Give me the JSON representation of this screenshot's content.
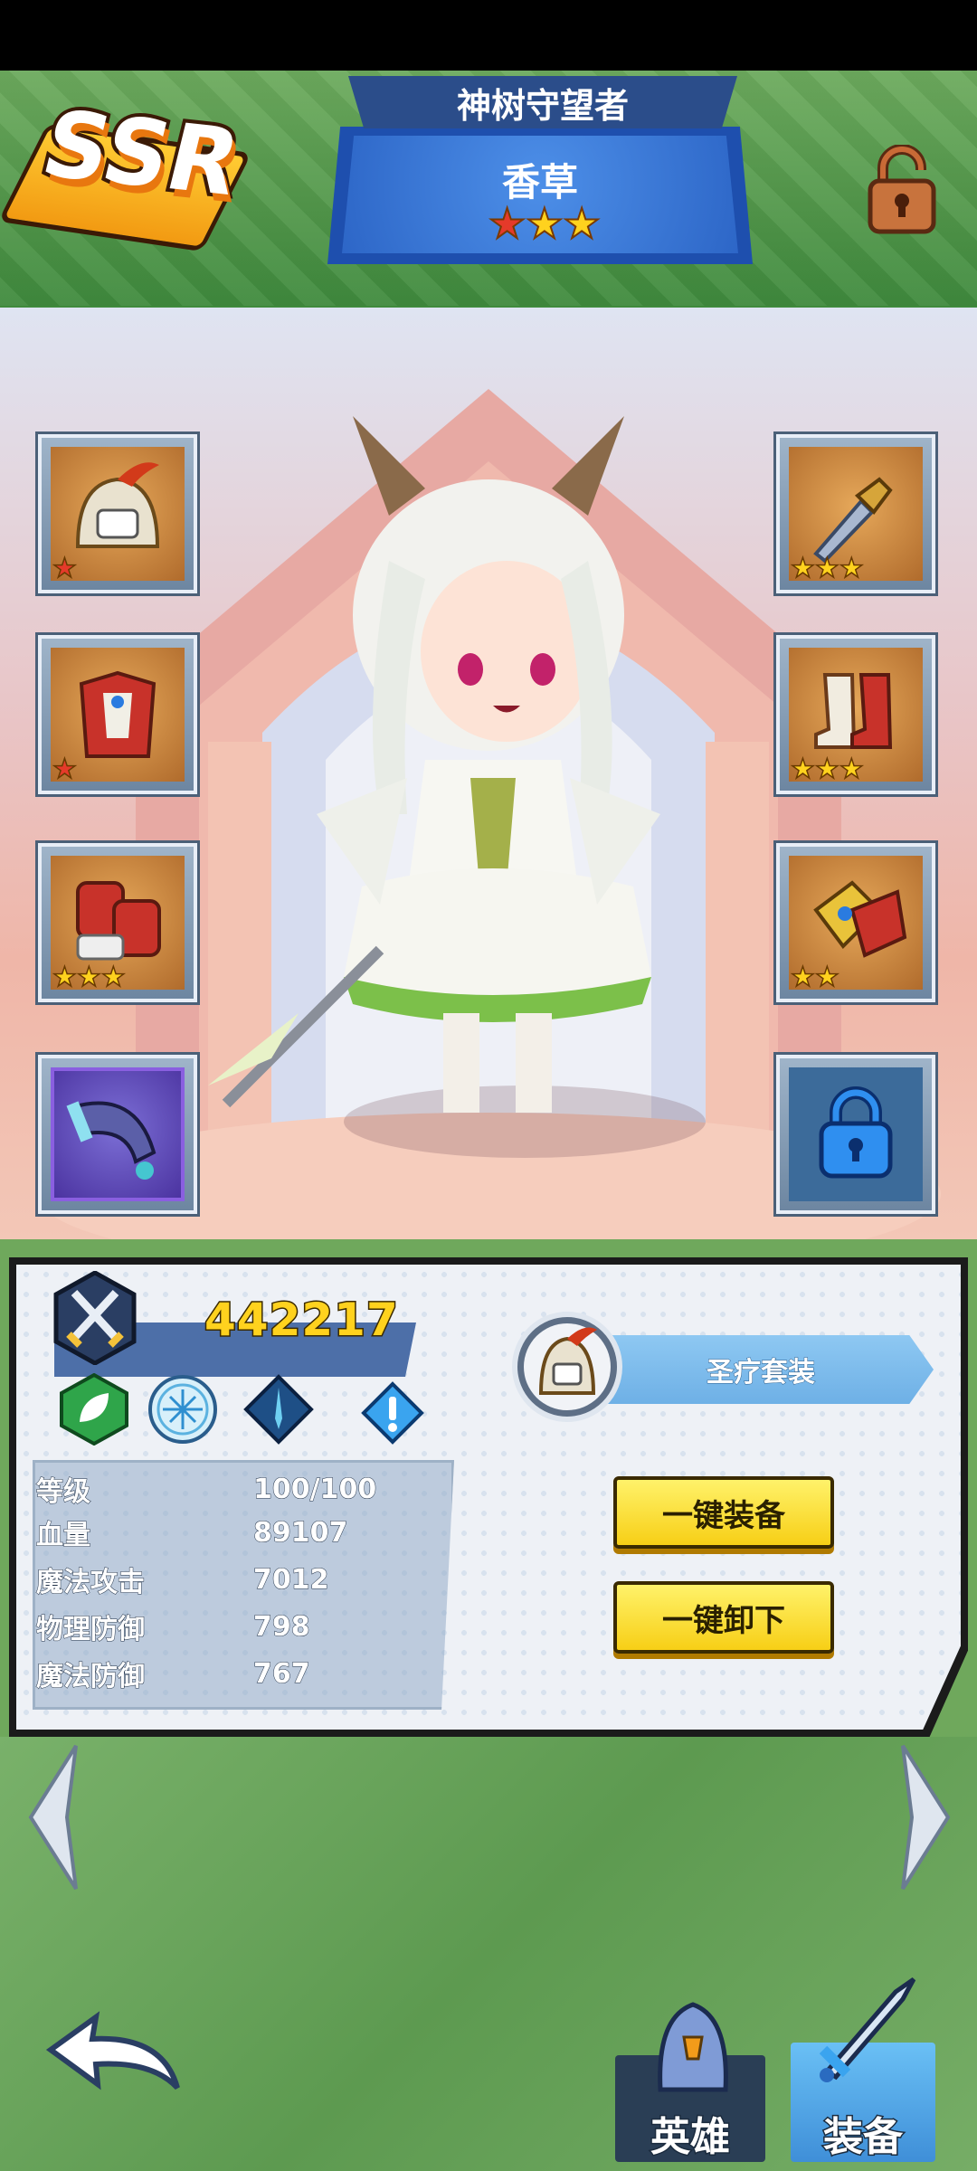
{
  "header": {
    "rarity": "SSR",
    "title": "神树守望者",
    "hero_name": "香草",
    "stars": 3,
    "lock_icon": "padlock-icon"
  },
  "equipment": {
    "left": [
      {
        "name": "helmet",
        "icon": "helmet-icon",
        "stars": 1,
        "star_color": "red"
      },
      {
        "name": "armor",
        "icon": "armor-icon",
        "stars": 1,
        "star_color": "red"
      },
      {
        "name": "gauntlets",
        "icon": "gauntlets-icon",
        "stars": 3,
        "star_color": "gold"
      },
      {
        "name": "horn",
        "icon": "horn-icon",
        "stars": 0,
        "star_color": "none"
      }
    ],
    "right": [
      {
        "name": "dagger",
        "icon": "dagger-icon",
        "stars": 3,
        "star_color": "gold"
      },
      {
        "name": "boots",
        "icon": "boots-icon",
        "stars": 3,
        "star_color": "gold"
      },
      {
        "name": "bracer",
        "icon": "bracer-icon",
        "stars": 2,
        "star_color": "gold"
      },
      {
        "name": "locked-slot",
        "icon": "lock-icon",
        "stars": 0,
        "star_color": "none"
      }
    ]
  },
  "panel": {
    "power": "442217",
    "attributes": [
      "leaf-icon",
      "frost-icon",
      "diamond-sword-icon",
      "alert-icon"
    ],
    "stats": [
      {
        "label": "等级",
        "value": "100/100"
      },
      {
        "label": "血量",
        "value": "89107"
      },
      {
        "label": "魔法攻击",
        "value": "7012"
      },
      {
        "label": "物理防御",
        "value": "798"
      },
      {
        "label": "魔法防御",
        "value": "767"
      }
    ],
    "set_name": "圣疗套装",
    "equip_all": "一键装备",
    "unequip_all": "一键卸下"
  },
  "bottom": {
    "tab_hero": "英雄",
    "tab_equipment": "装备"
  },
  "colors": {
    "header_green": "#4f9a47",
    "name_plate_blue": "#2d66c7",
    "power_yellow": "#ffd21e",
    "button_yellow": "#f7cf16",
    "set_bar_blue": "#6eb0e6"
  }
}
